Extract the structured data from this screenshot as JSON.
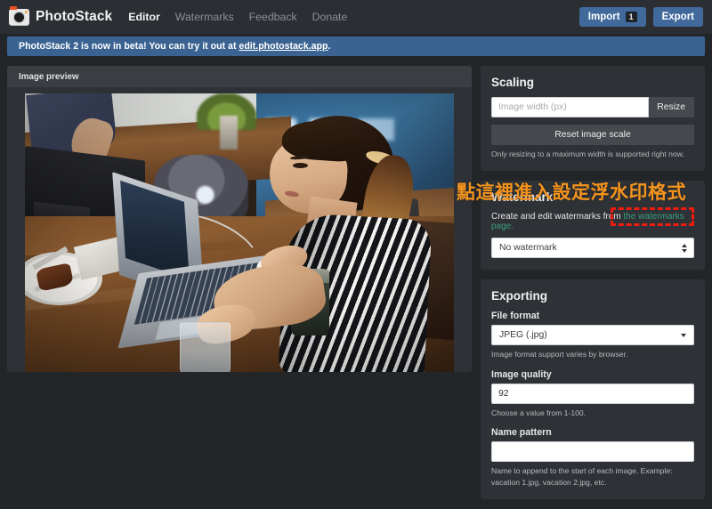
{
  "navbar": {
    "brand": "PhotoStack",
    "brand_icon": "camera-icon",
    "links": [
      {
        "label": "Editor",
        "active": true
      },
      {
        "label": "Watermarks",
        "active": false
      },
      {
        "label": "Feedback",
        "active": false
      },
      {
        "label": "Donate",
        "active": false
      }
    ],
    "import_label": "Import",
    "import_badge": "1",
    "export_label": "Export",
    "accent": "#41699b"
  },
  "banner": {
    "text_before": "PhotoStack 2 is now in beta! You can try it out at ",
    "link": "edit.photostack.app",
    "text_after": ".",
    "background": "#3a6392"
  },
  "preview": {
    "header_label": "Image preview",
    "image_alt": "Woman with ponytail working on a laptop at a wooden cafe table"
  },
  "scaling": {
    "title": "Scaling",
    "width_value": "",
    "width_placeholder": "Image width (px)",
    "resize_label": "Resize",
    "reset_label": "Reset image scale",
    "help": "Only resizing to a maximum width is supported right now."
  },
  "watermark": {
    "title": "Watermark",
    "desc_before": "Create and edit watermarks from ",
    "desc_link": "the watermarks page.",
    "selected": "No watermark",
    "link_color": "#3c9e7e"
  },
  "exporting": {
    "title": "Exporting",
    "file_format_label": "File format",
    "file_format_value": "JPEG (.jpg)",
    "file_format_help": "Image format support varies by browser.",
    "quality_label": "Image quality",
    "quality_value": "92",
    "quality_help": "Choose a value from 1-100.",
    "name_pattern_label": "Name pattern",
    "name_pattern_value": "",
    "name_pattern_help": "Name to append to the start of each image. Example: vacation 1.jpg, vacation 2.jpg, etc."
  },
  "annotation": {
    "text": "點這裡進入設定浮水印格式",
    "text_color": "#f5941d",
    "box_color": "#f01b0e"
  }
}
